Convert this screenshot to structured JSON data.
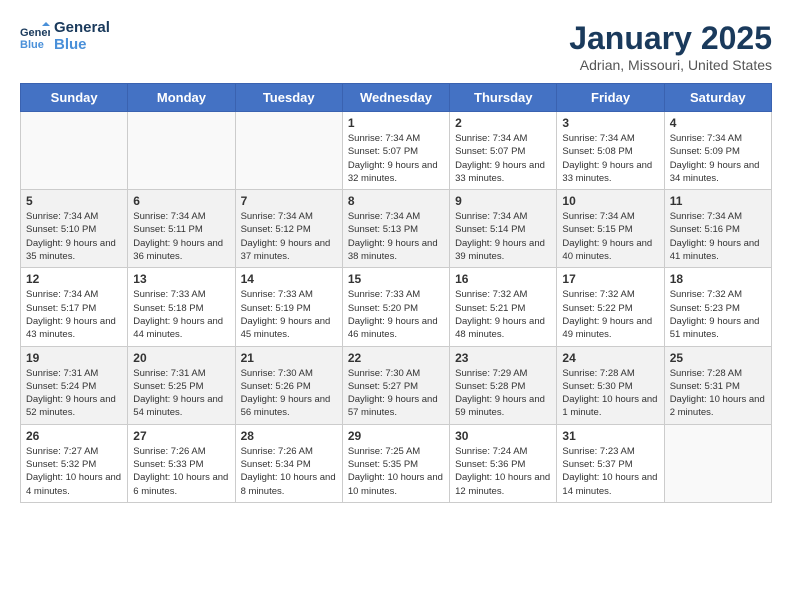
{
  "header": {
    "logo_line1": "General",
    "logo_line2": "Blue",
    "month": "January 2025",
    "location": "Adrian, Missouri, United States"
  },
  "days_of_week": [
    "Sunday",
    "Monday",
    "Tuesday",
    "Wednesday",
    "Thursday",
    "Friday",
    "Saturday"
  ],
  "weeks": [
    [
      {
        "num": "",
        "detail": ""
      },
      {
        "num": "",
        "detail": ""
      },
      {
        "num": "",
        "detail": ""
      },
      {
        "num": "1",
        "detail": "Sunrise: 7:34 AM\nSunset: 5:07 PM\nDaylight: 9 hours and 32 minutes."
      },
      {
        "num": "2",
        "detail": "Sunrise: 7:34 AM\nSunset: 5:07 PM\nDaylight: 9 hours and 33 minutes."
      },
      {
        "num": "3",
        "detail": "Sunrise: 7:34 AM\nSunset: 5:08 PM\nDaylight: 9 hours and 33 minutes."
      },
      {
        "num": "4",
        "detail": "Sunrise: 7:34 AM\nSunset: 5:09 PM\nDaylight: 9 hours and 34 minutes."
      }
    ],
    [
      {
        "num": "5",
        "detail": "Sunrise: 7:34 AM\nSunset: 5:10 PM\nDaylight: 9 hours and 35 minutes."
      },
      {
        "num": "6",
        "detail": "Sunrise: 7:34 AM\nSunset: 5:11 PM\nDaylight: 9 hours and 36 minutes."
      },
      {
        "num": "7",
        "detail": "Sunrise: 7:34 AM\nSunset: 5:12 PM\nDaylight: 9 hours and 37 minutes."
      },
      {
        "num": "8",
        "detail": "Sunrise: 7:34 AM\nSunset: 5:13 PM\nDaylight: 9 hours and 38 minutes."
      },
      {
        "num": "9",
        "detail": "Sunrise: 7:34 AM\nSunset: 5:14 PM\nDaylight: 9 hours and 39 minutes."
      },
      {
        "num": "10",
        "detail": "Sunrise: 7:34 AM\nSunset: 5:15 PM\nDaylight: 9 hours and 40 minutes."
      },
      {
        "num": "11",
        "detail": "Sunrise: 7:34 AM\nSunset: 5:16 PM\nDaylight: 9 hours and 41 minutes."
      }
    ],
    [
      {
        "num": "12",
        "detail": "Sunrise: 7:34 AM\nSunset: 5:17 PM\nDaylight: 9 hours and 43 minutes."
      },
      {
        "num": "13",
        "detail": "Sunrise: 7:33 AM\nSunset: 5:18 PM\nDaylight: 9 hours and 44 minutes."
      },
      {
        "num": "14",
        "detail": "Sunrise: 7:33 AM\nSunset: 5:19 PM\nDaylight: 9 hours and 45 minutes."
      },
      {
        "num": "15",
        "detail": "Sunrise: 7:33 AM\nSunset: 5:20 PM\nDaylight: 9 hours and 46 minutes."
      },
      {
        "num": "16",
        "detail": "Sunrise: 7:32 AM\nSunset: 5:21 PM\nDaylight: 9 hours and 48 minutes."
      },
      {
        "num": "17",
        "detail": "Sunrise: 7:32 AM\nSunset: 5:22 PM\nDaylight: 9 hours and 49 minutes."
      },
      {
        "num": "18",
        "detail": "Sunrise: 7:32 AM\nSunset: 5:23 PM\nDaylight: 9 hours and 51 minutes."
      }
    ],
    [
      {
        "num": "19",
        "detail": "Sunrise: 7:31 AM\nSunset: 5:24 PM\nDaylight: 9 hours and 52 minutes."
      },
      {
        "num": "20",
        "detail": "Sunrise: 7:31 AM\nSunset: 5:25 PM\nDaylight: 9 hours and 54 minutes."
      },
      {
        "num": "21",
        "detail": "Sunrise: 7:30 AM\nSunset: 5:26 PM\nDaylight: 9 hours and 56 minutes."
      },
      {
        "num": "22",
        "detail": "Sunrise: 7:30 AM\nSunset: 5:27 PM\nDaylight: 9 hours and 57 minutes."
      },
      {
        "num": "23",
        "detail": "Sunrise: 7:29 AM\nSunset: 5:28 PM\nDaylight: 9 hours and 59 minutes."
      },
      {
        "num": "24",
        "detail": "Sunrise: 7:28 AM\nSunset: 5:30 PM\nDaylight: 10 hours and 1 minute."
      },
      {
        "num": "25",
        "detail": "Sunrise: 7:28 AM\nSunset: 5:31 PM\nDaylight: 10 hours and 2 minutes."
      }
    ],
    [
      {
        "num": "26",
        "detail": "Sunrise: 7:27 AM\nSunset: 5:32 PM\nDaylight: 10 hours and 4 minutes."
      },
      {
        "num": "27",
        "detail": "Sunrise: 7:26 AM\nSunset: 5:33 PM\nDaylight: 10 hours and 6 minutes."
      },
      {
        "num": "28",
        "detail": "Sunrise: 7:26 AM\nSunset: 5:34 PM\nDaylight: 10 hours and 8 minutes."
      },
      {
        "num": "29",
        "detail": "Sunrise: 7:25 AM\nSunset: 5:35 PM\nDaylight: 10 hours and 10 minutes."
      },
      {
        "num": "30",
        "detail": "Sunrise: 7:24 AM\nSunset: 5:36 PM\nDaylight: 10 hours and 12 minutes."
      },
      {
        "num": "31",
        "detail": "Sunrise: 7:23 AM\nSunset: 5:37 PM\nDaylight: 10 hours and 14 minutes."
      },
      {
        "num": "",
        "detail": ""
      }
    ]
  ]
}
